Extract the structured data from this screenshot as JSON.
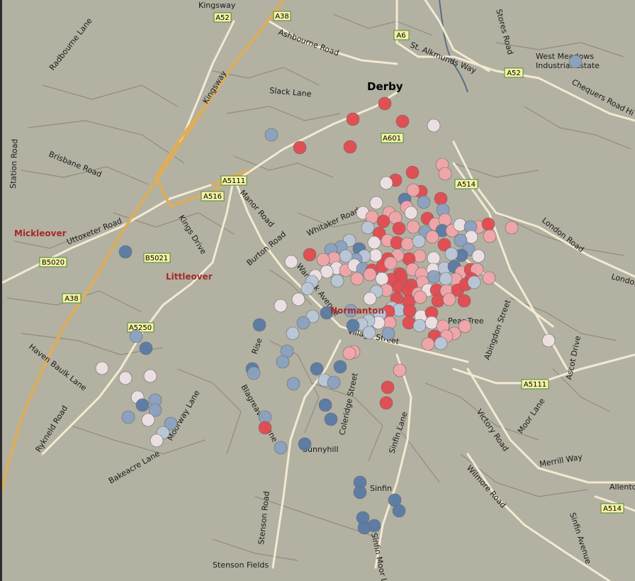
{
  "map": {
    "city_label": "Derby",
    "town_labels": {
      "mickleover": "Mickleover",
      "littleover": "Littleover",
      "normanton": "Normanton"
    },
    "road_shields": {
      "a52_top": "A52",
      "a38_top": "A38",
      "a6": "A6",
      "a52_east": "A52",
      "a601": "A601",
      "a5111_west": "A5111",
      "a516": "A516",
      "a514_north": "A514",
      "b5021": "B5021",
      "b5020": "B5020",
      "a38_west": "A38",
      "a5250": "A5250",
      "a5111_east": "A5111",
      "a514_south": "A514"
    },
    "road_labels": {
      "kingsway_top": "Kingsway",
      "radbourne_lane": "Radbourne Lane",
      "kingsway_diag": "Kingsway",
      "ashbourne_road": "Ashbourne Road",
      "st_alkmunds_way": "St. Alkmunds Way",
      "stores_road": "Stores Road",
      "west_meadows": "West Meadows",
      "industrial_estate": "Industrial Estate",
      "chequers_road": "Chequers Road",
      "hi": "Hi",
      "slack_lane": "Slack Lane",
      "station_road": "Station Road",
      "brisbane_road": "Brisbane Road",
      "manor_road": "Manor Road",
      "kings_drive": "Kings Drive",
      "uttoxeter_road": "Uttoxeter Road",
      "whitaker_road": "Whitaker Road",
      "burton_road": "Burton Road",
      "warwick_avenue": "Warwick Avenue",
      "london_road": "London Road",
      "london": "London",
      "pear_tree": "Pear Tree",
      "abingdon_street": "Abingdon Street",
      "ascot_drive": "Ascot Drive",
      "village_street": "Village Street",
      "haven_baulk_lane": "Haven Baulk Lane",
      "rykneld_road": "Rykneld Road",
      "moorway_lane": "Moorway Lane",
      "bakeacre_lane": "Bakeacre Lane",
      "blagreaves_lane": "Blagreaves Lane",
      "stenson_road": "Stenson Road",
      "stenson_fields": "Stenson Fields",
      "sunnyhill": "Sunnyhill",
      "coleridge_street": "Coleridge Street",
      "sinfin_lane": "Sinfin Lane",
      "sinfin": "Sinfin",
      "sinfin_moor_lane": "Sinfin Moor Lane",
      "victory_road": "Victory Road",
      "moor_lane": "Moor Lane",
      "wilmore_road": "Wilmore Road",
      "merrill_way": "Merrill Way",
      "allenton": "Allenton",
      "sinfin_avenue": "Sinfin Avenue",
      "rise": "Rise"
    },
    "colors": {
      "background": "#b3b1a2",
      "street": "#928c7c",
      "main_road": "#f3ead2",
      "major_road": "#dcae5c",
      "river": "#5a6d86",
      "red": "#e34a4f",
      "light_red": "#f1a5aa",
      "pale": "#eee2e6",
      "light_blue": "#b9c7d8",
      "blue": "#8aa1c0",
      "dark_blue": "#5a7aa4"
    },
    "points": [
      [
        543,
        146,
        "red"
      ],
      [
        498,
        168,
        "red"
      ],
      [
        568,
        171,
        "red"
      ],
      [
        612,
        177,
        "pale"
      ],
      [
        494,
        207,
        "red"
      ],
      [
        423,
        208,
        "red"
      ],
      [
        383,
        190,
        "blue"
      ],
      [
        812,
        87,
        "blue"
      ],
      [
        582,
        243,
        "red"
      ],
      [
        558,
        254,
        "red"
      ],
      [
        545,
        258,
        "pale"
      ],
      [
        624,
        232,
        "light_red"
      ],
      [
        628,
        245,
        "light_red"
      ],
      [
        594,
        270,
        "red"
      ],
      [
        583,
        268,
        "light_red"
      ],
      [
        571,
        281,
        "dark_blue"
      ],
      [
        531,
        286,
        "pale"
      ],
      [
        549,
        300,
        "light_red"
      ],
      [
        574,
        292,
        "light_red"
      ],
      [
        598,
        285,
        "blue"
      ],
      [
        622,
        280,
        "red"
      ],
      [
        625,
        296,
        "blue"
      ],
      [
        512,
        300,
        "pale"
      ],
      [
        525,
        306,
        "light_red"
      ],
      [
        541,
        312,
        "red"
      ],
      [
        558,
        307,
        "light_red"
      ],
      [
        580,
        300,
        "pale"
      ],
      [
        603,
        308,
        "red"
      ],
      [
        614,
        316,
        "light_red"
      ],
      [
        628,
        310,
        "light_red"
      ],
      [
        519,
        321,
        "light_blue"
      ],
      [
        535,
        329,
        "red"
      ],
      [
        563,
        322,
        "red"
      ],
      [
        583,
        320,
        "light_red"
      ],
      [
        600,
        327,
        "blue"
      ],
      [
        624,
        325,
        "dark_blue"
      ],
      [
        638,
        325,
        "light_red"
      ],
      [
        649,
        317,
        "pale"
      ],
      [
        675,
        320,
        "light_red"
      ],
      [
        689,
        316,
        "red"
      ],
      [
        664,
        320,
        "blue"
      ],
      [
        722,
        321,
        "light_red"
      ],
      [
        691,
        333,
        "light_red"
      ],
      [
        665,
        334,
        "pale"
      ],
      [
        650,
        339,
        "blue"
      ],
      [
        493,
        339,
        "light_blue"
      ],
      [
        481,
        348,
        "blue"
      ],
      [
        467,
        352,
        "blue"
      ],
      [
        507,
        351,
        "dark_blue"
      ],
      [
        528,
        342,
        "pale"
      ],
      [
        547,
        339,
        "light_red"
      ],
      [
        560,
        342,
        "red"
      ],
      [
        575,
        344,
        "light_red"
      ],
      [
        591,
        340,
        "light_blue"
      ],
      [
        610,
        334,
        "light_red"
      ],
      [
        627,
        345,
        "red"
      ],
      [
        661,
        352,
        "blue"
      ],
      [
        675,
        361,
        "pale"
      ],
      [
        651,
        360,
        "dark_blue"
      ],
      [
        637,
        358,
        "light_blue"
      ],
      [
        612,
        364,
        "pale"
      ],
      [
        592,
        361,
        "light_red"
      ],
      [
        577,
        365,
        "red"
      ],
      [
        561,
        360,
        "light_red"
      ],
      [
        547,
        365,
        "red"
      ],
      [
        530,
        360,
        "pale"
      ],
      [
        514,
        361,
        "light_blue"
      ],
      [
        502,
        366,
        "blue"
      ],
      [
        488,
        361,
        "light_blue"
      ],
      [
        471,
        364,
        "light_red"
      ],
      [
        456,
        366,
        "light_red"
      ],
      [
        437,
        359,
        "red"
      ],
      [
        411,
        369,
        "pale"
      ],
      [
        475,
        378,
        "pale"
      ],
      [
        488,
        381,
        "light_red"
      ],
      [
        500,
        374,
        "pale"
      ],
      [
        512,
        379,
        "blue"
      ],
      [
        525,
        381,
        "red"
      ],
      [
        540,
        375,
        "red"
      ],
      [
        551,
        371,
        "light_red"
      ],
      [
        564,
        386,
        "red"
      ],
      [
        582,
        380,
        "light_red"
      ],
      [
        595,
        386,
        "light_red"
      ],
      [
        611,
        380,
        "pale"
      ],
      [
        627,
        378,
        "light_blue"
      ],
      [
        641,
        376,
        "dark_blue"
      ],
      [
        651,
        384,
        "light_red"
      ],
      [
        664,
        380,
        "red"
      ],
      [
        673,
        380,
        "light_red"
      ],
      [
        690,
        392,
        "light_red"
      ],
      [
        665,
        393,
        "red"
      ],
      [
        643,
        394,
        "light_red"
      ],
      [
        629,
        393,
        "light_blue"
      ],
      [
        612,
        390,
        "blue"
      ],
      [
        596,
        398,
        "light_red"
      ],
      [
        580,
        402,
        "red"
      ],
      [
        566,
        391,
        "red"
      ],
      [
        552,
        394,
        "red"
      ],
      [
        539,
        393,
        "pale"
      ],
      [
        522,
        387,
        "light_red"
      ],
      [
        504,
        393,
        "light_red"
      ],
      [
        476,
        396,
        "light_blue"
      ],
      [
        461,
        383,
        "pale"
      ],
      [
        445,
        389,
        "pale"
      ],
      [
        440,
        397,
        "light_blue"
      ],
      [
        434,
        407,
        "light_blue"
      ],
      [
        562,
        404,
        "red"
      ],
      [
        576,
        409,
        "red"
      ],
      [
        590,
        414,
        "light_red"
      ],
      [
        604,
        409,
        "pale"
      ],
      [
        616,
        409,
        "red"
      ],
      [
        630,
        410,
        "light_red"
      ],
      [
        646,
        409,
        "red"
      ],
      [
        657,
        401,
        "red"
      ],
      [
        669,
        398,
        "light_blue"
      ],
      [
        545,
        409,
        "light_red"
      ],
      [
        531,
        411,
        "light_blue"
      ],
      [
        522,
        421,
        "pale"
      ],
      [
        560,
        421,
        "red"
      ],
      [
        577,
        425,
        "red"
      ],
      [
        593,
        419,
        "light_red"
      ],
      [
        618,
        424,
        "red"
      ],
      [
        634,
        422,
        "light_red"
      ],
      [
        655,
        424,
        "red"
      ],
      [
        553,
        434,
        "light_blue"
      ],
      [
        563,
        437,
        "light_blue"
      ],
      [
        578,
        438,
        "red"
      ],
      [
        594,
        446,
        "pale"
      ],
      [
        609,
        441,
        "red"
      ],
      [
        548,
        439,
        "red"
      ],
      [
        536,
        443,
        "light_blue"
      ],
      [
        495,
        438,
        "blue"
      ],
      [
        461,
        441,
        "dark_blue"
      ],
      [
        441,
        446,
        "light_blue"
      ],
      [
        421,
        422,
        "pale"
      ],
      [
        396,
        431,
        "pale"
      ],
      [
        577,
        455,
        "red"
      ],
      [
        592,
        459,
        "light_blue"
      ],
      [
        609,
        455,
        "pale"
      ],
      [
        625,
        460,
        "light_red"
      ],
      [
        641,
        470,
        "light_red"
      ],
      [
        656,
        460,
        "light_red"
      ],
      [
        630,
        474,
        "light_red"
      ],
      [
        613,
        474,
        "red"
      ],
      [
        604,
        485,
        "light_red"
      ],
      [
        622,
        484,
        "light_blue"
      ],
      [
        550,
        455,
        "light_red"
      ],
      [
        534,
        455,
        "pale"
      ],
      [
        520,
        452,
        "light_blue"
      ],
      [
        510,
        457,
        "light_blue"
      ],
      [
        548,
        470,
        "blue"
      ],
      [
        521,
        469,
        "light_blue"
      ],
      [
        498,
        459,
        "dark_blue"
      ],
      [
        774,
        480,
        "pale"
      ],
      [
        428,
        455,
        "blue"
      ],
      [
        413,
        470,
        "light_blue"
      ],
      [
        366,
        458,
        "dark_blue"
      ],
      [
        405,
        495,
        "blue"
      ],
      [
        399,
        510,
        "blue"
      ],
      [
        414,
        541,
        "blue"
      ],
      [
        356,
        520,
        "dark_blue"
      ],
      [
        358,
        526,
        "blue"
      ],
      [
        447,
        520,
        "dark_blue"
      ],
      [
        480,
        517,
        "dark_blue"
      ],
      [
        458,
        536,
        "light_blue"
      ],
      [
        471,
        539,
        "blue"
      ],
      [
        499,
        496,
        "light_red"
      ],
      [
        493,
        498,
        "light_red"
      ],
      [
        564,
        522,
        "light_red"
      ],
      [
        547,
        546,
        "red"
      ],
      [
        545,
        568,
        "red"
      ],
      [
        459,
        571,
        "dark_blue"
      ],
      [
        467,
        591,
        "dark_blue"
      ],
      [
        374,
        588,
        "blue"
      ],
      [
        374,
        603,
        "red"
      ],
      [
        396,
        631,
        "blue"
      ],
      [
        430,
        626,
        "dark_blue"
      ],
      [
        192,
        474,
        "blue"
      ],
      [
        206,
        491,
        "dark_blue"
      ],
      [
        144,
        519,
        "pale"
      ],
      [
        177,
        533,
        "pale"
      ],
      [
        212,
        530,
        "pale"
      ],
      [
        194,
        560,
        "pale"
      ],
      [
        219,
        564,
        "blue"
      ],
      [
        219,
        578,
        "blue"
      ],
      [
        201,
        571,
        "dark_blue"
      ],
      [
        209,
        592,
        "pale"
      ],
      [
        181,
        588,
        "blue"
      ],
      [
        241,
        597,
        "blue"
      ],
      [
        230,
        610,
        "light_blue"
      ],
      [
        221,
        621,
        "pale"
      ],
      [
        508,
        680,
        "dark_blue"
      ],
      [
        508,
        694,
        "dark_blue"
      ],
      [
        557,
        705,
        "dark_blue"
      ],
      [
        563,
        720,
        "dark_blue"
      ],
      [
        512,
        730,
        "dark_blue"
      ],
      [
        528,
        741,
        "dark_blue"
      ],
      [
        514,
        744,
        "dark_blue"
      ],
      [
        177,
        355,
        "dark_blue"
      ]
    ]
  }
}
